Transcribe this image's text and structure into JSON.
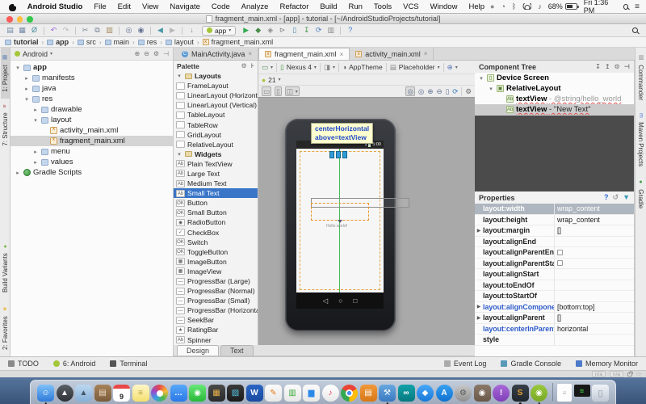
{
  "icons": {
    "close": "×",
    "caret": "▾",
    "tree_open": "▾",
    "tree_closed": "▸",
    "expand": "▶",
    "back_nav": "◁",
    "home_nav": "○",
    "recents_nav": "□",
    "check": "✓"
  },
  "menubar": {
    "items": [
      "Android Studio",
      "File",
      "Edit",
      "View",
      "Navigate",
      "Code",
      "Analyze",
      "Refactor",
      "Build",
      "Run",
      "Tools",
      "VCS",
      "Window",
      "Help"
    ],
    "status_icons": [
      {
        "name": "notifications-icon",
        "glyph": "●",
        "color": "#8a8a8a"
      },
      {
        "name": "time-machine-icon",
        "glyph": "◔",
        "color": "#555555"
      },
      {
        "name": "bluetooth-icon",
        "glyph": "ᛒ",
        "color": "#444444"
      },
      {
        "name": "wifi-icon",
        "glyph": "wifi",
        "color": "#444444"
      },
      {
        "name": "volume-icon",
        "glyph": "♪",
        "color": "#444444"
      }
    ],
    "battery_label": "68%",
    "clock": "Fri 1:36 PM"
  },
  "window": {
    "title": "fragment_main.xml - [app] - tutorial - [~/AndroidStudioProjects/tutorial]"
  },
  "toolbar": {
    "run_config": "app",
    "left_icons": [
      {
        "name": "open-icon",
        "glyph": "▤",
        "color": "#7288a8"
      },
      {
        "name": "save-all-icon",
        "glyph": "▦",
        "color": "#7288a8"
      },
      {
        "name": "synchronize-icon",
        "glyph": "Ø",
        "color": "#4a8a9a"
      },
      {
        "sep": true
      },
      {
        "name": "undo-icon",
        "glyph": "↶",
        "color": "#9a6ad8"
      },
      {
        "name": "redo-icon",
        "glyph": "↷",
        "color": "#b5b5b5"
      },
      {
        "sep": true
      },
      {
        "name": "cut-icon",
        "glyph": "✂",
        "color": "#708090"
      },
      {
        "name": "copy-icon",
        "glyph": "⧉",
        "color": "#708090"
      },
      {
        "name": "paste-icon",
        "glyph": "▥",
        "color": "#a08858"
      },
      {
        "sep": true
      },
      {
        "name": "find-icon",
        "glyph": "◎",
        "color": "#607090"
      },
      {
        "name": "replace-icon",
        "glyph": "◉",
        "color": "#607090"
      },
      {
        "sep": true
      },
      {
        "name": "back-icon",
        "glyph": "◀",
        "color": "#4a9aa8"
      },
      {
        "name": "forward-icon",
        "glyph": "▶",
        "color": "#b8b8b8"
      },
      {
        "sep": true
      },
      {
        "name": "collapse-icon",
        "glyph": "↓",
        "color": "#888888"
      }
    ],
    "right_icons": [
      {
        "name": "run-icon",
        "glyph": "▶",
        "color": "#34a853"
      },
      {
        "name": "debug-icon",
        "glyph": "◆",
        "color": "#4a8a4a"
      },
      {
        "name": "coverage-icon",
        "glyph": "◈",
        "color": "#888888"
      },
      {
        "name": "attach-debugger-icon",
        "glyph": "⊳",
        "color": "#888888"
      },
      {
        "name": "avd-manager-icon",
        "glyph": "▯",
        "color": "#4a8ab0"
      },
      {
        "name": "sdk-manager-icon",
        "glyph": "↧",
        "color": "#4a9a4a"
      },
      {
        "name": "sync-gradle-icon",
        "glyph": "⟳",
        "color": "#4a7ab8"
      },
      {
        "name": "monitor-icon",
        "glyph": "▥",
        "color": "#888888"
      },
      {
        "sep": true
      },
      {
        "name": "help-icon",
        "glyph": "?",
        "color": "#3a7ad8"
      }
    ]
  },
  "breadcrumbs": [
    {
      "label": "tutorial",
      "bold": true
    },
    {
      "label": "app",
      "bold": true
    },
    {
      "label": "src"
    },
    {
      "label": "main"
    },
    {
      "label": "res"
    },
    {
      "label": "layout"
    },
    {
      "label": "fragment_main.xml",
      "file": true
    }
  ],
  "left_strip": {
    "top": [
      {
        "label": "1: Project",
        "glyph": "▦",
        "color": "#6a8ab8",
        "active": true
      },
      {
        "label": "7: Structure",
        "glyph": "≡",
        "color": "#b05050"
      }
    ],
    "bottom": [
      {
        "label": "Build Variants",
        "glyph": "●",
        "color": "#7ab648"
      },
      {
        "label": "2: Favorites",
        "glyph": "★",
        "color": "#e8b838"
      }
    ]
  },
  "project": {
    "selector": "Android",
    "header_icons": [
      {
        "name": "locate-icon",
        "glyph": "⊕"
      },
      {
        "name": "collapse-all-icon",
        "glyph": "⊖"
      },
      {
        "name": "settings-icon",
        "glyph": "⚙"
      },
      {
        "name": "hide-panel-icon",
        "glyph": "⊣"
      }
    ],
    "tree": [
      {
        "label": "app",
        "depth": 0,
        "arrow": "open",
        "icon": "folder",
        "bold": true
      },
      {
        "label": "manifests",
        "depth": 1,
        "arrow": "closed",
        "icon": "folder"
      },
      {
        "label": "java",
        "depth": 1,
        "arrow": "closed",
        "icon": "folder"
      },
      {
        "label": "res",
        "depth": 1,
        "arrow": "open",
        "icon": "folder"
      },
      {
        "label": "drawable",
        "depth": 2,
        "arrow": "closed",
        "icon": "folder"
      },
      {
        "label": "layout",
        "depth": 2,
        "arrow": "open",
        "icon": "folder"
      },
      {
        "label": "activity_main.xml",
        "depth": 3,
        "icon": "xml"
      },
      {
        "label": "fragment_main.xml",
        "depth": 3,
        "icon": "xml",
        "selected": true
      },
      {
        "label": "menu",
        "depth": 2,
        "arrow": "closed",
        "icon": "folder"
      },
      {
        "label": "values",
        "depth": 2,
        "arrow": "closed",
        "icon": "folder"
      },
      {
        "label": "Gradle Scripts",
        "depth": 0,
        "arrow": "closed",
        "icon": "gradle"
      }
    ]
  },
  "editor_tabs": [
    {
      "label": "MainActivity.java",
      "kind": "java"
    },
    {
      "label": "fragment_main.xml",
      "kind": "xml",
      "active": true
    },
    {
      "label": "activity_main.xml",
      "kind": "xml"
    }
  ],
  "palette": {
    "title": "Palette",
    "header_icons": [
      {
        "name": "settings-icon",
        "glyph": "⚙"
      },
      {
        "name": "pin-icon",
        "glyph": "⊦"
      }
    ],
    "sections": [
      {
        "title": "Layouts",
        "items": [
          "FrameLayout",
          "LinearLayout (Horizontal)",
          "LinearLayout (Vertical)",
          "TableLayout",
          "TableRow",
          "GridLayout",
          "RelativeLayout"
        ]
      },
      {
        "title": "Widgets",
        "items": [
          "Plain TextView",
          "Large Text",
          "Medium Text",
          "Small Text",
          "Button",
          "Small Button",
          "RadioButton",
          "CheckBox",
          "Switch",
          "ToggleButton",
          "ImageButton",
          "ImageView",
          "ProgressBar (Large)",
          "ProgressBar (Normal)",
          "ProgressBar (Small)",
          "ProgressBar (Horizontal)",
          "SeekBar",
          "RatingBar",
          "Spinner"
        ]
      }
    ],
    "selected_item": "Small Text"
  },
  "design_bar": {
    "row1": [
      {
        "name": "configuration-menu",
        "glyph": "▭",
        "gcolor": "#5a8a5a",
        "caret": true
      },
      {
        "sep": true
      },
      {
        "name": "device-selector",
        "glyph": "▯",
        "gcolor": "#4a9a4a",
        "label": "Nexus 4",
        "caret": true
      },
      {
        "sep": true
      },
      {
        "name": "orientation-selector",
        "glyph": "◨",
        "gcolor": "#888888",
        "caret": true
      },
      {
        "sep": true
      },
      {
        "name": "theme-selector",
        "glyph": "◑",
        "gcolor": "#555555",
        "label": "AppTheme"
      },
      {
        "sep": true
      },
      {
        "name": "placeholder-selector",
        "glyph": "▤",
        "gcolor": "#888888",
        "label": "Placeholder",
        "caret": true
      },
      {
        "sep": true
      },
      {
        "name": "locale-selector",
        "glyph": "⊕",
        "gcolor": "#5a7ab8",
        "caret": true
      }
    ],
    "row2": [
      {
        "name": "api-level-selector",
        "glyph": "●",
        "gcolor": "#a4c639",
        "label": "21",
        "caret": true
      }
    ],
    "row3_left": [
      {
        "name": "show-bounds-icon",
        "glyph": "▭",
        "gcolor": "#777777",
        "boxed": true
      },
      {
        "name": "device-frame-icon",
        "glyph": "▯",
        "gcolor": "#777777",
        "boxed": true
      },
      {
        "name": "overlay-menu-icon",
        "glyph": "◫",
        "gcolor": "#777777",
        "boxed": true,
        "caret": true
      }
    ],
    "row3_right": [
      {
        "name": "zoom-fit-icon",
        "glyph": "◎",
        "gcolor": "#607090",
        "boxed": true
      },
      {
        "name": "zoom-actual-icon",
        "glyph": "◎",
        "gcolor": "#607090"
      },
      {
        "name": "zoom-in-icon",
        "glyph": "⊕",
        "gcolor": "#607090"
      },
      {
        "name": "zoom-out-icon",
        "glyph": "⊖",
        "gcolor": "#607090"
      },
      {
        "name": "zoom-page-icon",
        "glyph": "▯",
        "gcolor": "#607090"
      },
      {
        "name": "refresh-icon",
        "glyph": "⟳",
        "gcolor": "#3a7ab8"
      },
      {
        "sep": true
      },
      {
        "name": "settings-icon",
        "glyph": "⚙",
        "gcolor": "#666666"
      }
    ]
  },
  "canvas": {
    "tooltip_line1": "centerHorizontal",
    "tooltip_line2": "above=textView",
    "status_time": "5:00",
    "hello_text": "Hello world!"
  },
  "component_tree": {
    "title": "Component Tree",
    "header_icons": [
      {
        "name": "expand-all-icon",
        "glyph": "↧"
      },
      {
        "name": "collapse-all-icon",
        "glyph": "↥"
      },
      {
        "name": "settings-icon",
        "glyph": "⚙"
      },
      {
        "name": "hide-panel-icon",
        "glyph": "⊣"
      }
    ],
    "nodes": [
      {
        "label": "Device Screen",
        "depth": 0,
        "arrow": true,
        "icon": "▯"
      },
      {
        "label": "RelativeLayout",
        "depth": 1,
        "arrow": true,
        "icon": "▣"
      },
      {
        "label": "textView",
        "suffix": "- @string/hello_world",
        "depth": 2,
        "icon": "Ab",
        "error": true
      },
      {
        "label": "textView",
        "suffix": "- \"New Text\"",
        "depth": 2,
        "icon": "Ab",
        "error": true,
        "selected": true
      }
    ]
  },
  "properties": {
    "title": "Properties",
    "header_icons": [
      {
        "name": "help-icon",
        "glyph": "?",
        "color": "#2a6ad8"
      },
      {
        "name": "revert-icon",
        "glyph": "↺",
        "color": "#999999"
      },
      {
        "name": "filter-icon",
        "glyph": "▼",
        "color": "#3a9ab8"
      }
    ],
    "rows": [
      {
        "name": "layout:width",
        "value": "wrap_content",
        "selected": true
      },
      {
        "name": "layout:height",
        "value": "wrap_content"
      },
      {
        "name": "layout:margin",
        "value": "[]",
        "expand": true
      },
      {
        "name": "layout:alignEnd",
        "value": ""
      },
      {
        "name": "layout:alignParentEnd",
        "value": "",
        "checkbox": true
      },
      {
        "name": "layout:alignParentStart",
        "value": "",
        "checkbox": true
      },
      {
        "name": "layout:alignStart",
        "value": ""
      },
      {
        "name": "layout:toEndOf",
        "value": ""
      },
      {
        "name": "layout:toStartOf",
        "value": ""
      },
      {
        "name": "layout:alignComponent",
        "value": "[bottom:top]",
        "expand": true,
        "blue": true
      },
      {
        "name": "layout:alignParent",
        "value": "[]",
        "expand": true
      },
      {
        "name": "layout:centerInParent",
        "value": "horizontal",
        "blue": true
      },
      {
        "name": "style",
        "value": ""
      }
    ]
  },
  "right_strip": [
    {
      "label": "Commander",
      "glyph": "▥",
      "color": "#888888"
    },
    {
      "label": "Maven Projects",
      "glyph": "m",
      "color": "#5a7ad8"
    },
    {
      "label": "Gradle",
      "glyph": "●",
      "color": "#4a9a4a"
    }
  ],
  "bottom_bar": {
    "left": [
      {
        "label": "TODO",
        "glyph": "▤",
        "color": "#8a8a8a"
      },
      {
        "label": "6: Android",
        "glyph": "●",
        "color": "#a4c639"
      },
      {
        "label": "Terminal",
        "glyph": "▣",
        "color": "#555555"
      }
    ],
    "right": [
      {
        "label": "Event Log",
        "glyph": "▤",
        "color": "#aaaaaa"
      },
      {
        "label": "Gradle Console",
        "glyph": "▣",
        "color": "#5a9ab8"
      },
      {
        "label": "Memory Monitor",
        "glyph": "▆",
        "color": "#4a7ac8"
      }
    ]
  },
  "status_strip": {
    "left_value": "n/a",
    "right_value": "n/a"
  },
  "design_text_tabs": [
    {
      "label": "Design",
      "active": true
    },
    {
      "label": "Text"
    }
  ],
  "dock": [
    {
      "name": "finder-icon",
      "glyph": "☺",
      "c1": "#7cc0f8",
      "c2": "#2f7ad8",
      "dot": true
    },
    {
      "name": "launchpad-icon",
      "glyph": "▲",
      "c1": "#5a5f66",
      "c2": "#2e3238",
      "circ": true
    },
    {
      "name": "preview-icon",
      "glyph": "▲",
      "c1": "#bcd8f0",
      "c2": "#88b0d8",
      "fg": "#445566"
    },
    {
      "name": "contacts-icon",
      "glyph": "▤",
      "c1": "#a8825a",
      "c2": "#7a5c3a",
      "fg": "#f0e0c8"
    },
    {
      "name": "calendar-icon",
      "glyph": "9"
    },
    {
      "name": "notes-icon",
      "glyph": "≡",
      "c1": "#fdf6c8",
      "c2": "#f5e070",
      "fg": "#b8a040"
    },
    {
      "name": "photos-icon",
      "glyph": ""
    },
    {
      "name": "messages-icon",
      "glyph": "…",
      "c1": "#58a8f8",
      "c2": "#2a78e8"
    },
    {
      "name": "facetime-icon",
      "glyph": "◉",
      "c1": "#68e878",
      "c2": "#28b838"
    },
    {
      "name": "photo-booth-icon",
      "glyph": "▦",
      "c1": "#4a4a4a",
      "c2": "#2a2a2a",
      "fg": "#e8b048"
    },
    {
      "name": "image-capture-icon",
      "glyph": "▨",
      "c1": "#3a3a3a",
      "c2": "#1a1a1a",
      "fg": "#58c8e8"
    },
    {
      "name": "word-icon",
      "glyph": "W",
      "c1": "#2a66c4",
      "c2": "#1a4aa0"
    },
    {
      "name": "pages-icon",
      "glyph": "✎",
      "c1": "#fafafa",
      "c2": "#e8e8e8",
      "fg": "#e87818"
    },
    {
      "name": "numbers-icon",
      "glyph": "▥",
      "c1": "#fafafa",
      "c2": "#e8e8e8",
      "fg": "#3aa838"
    },
    {
      "name": "keynote-icon",
      "glyph": "▆",
      "c1": "#fafafa",
      "c2": "#e8e8e8",
      "fg": "#2a88e8"
    },
    {
      "name": "itunes-icon",
      "glyph": "♪",
      "c1": "#ffffff",
      "c2": "#e8e8e8",
      "fg": "#e83858",
      "circ": true
    },
    {
      "name": "chrome-icon",
      "glyph": "",
      "circ": true
    },
    {
      "name": "ibooks-icon",
      "glyph": "▤",
      "c1": "#f0983a",
      "c2": "#d87818"
    },
    {
      "name": "xcode-icon",
      "glyph": "⚒",
      "c1": "#68a8e0",
      "c2": "#3a78c0",
      "dot": true
    },
    {
      "name": "arduino-icon",
      "glyph": "∞",
      "c1": "#12a2a8",
      "c2": "#087880"
    },
    {
      "name": "safari-icon",
      "glyph": "◆",
      "c1": "#48a8f8",
      "c2": "#1878d8",
      "circ": true
    },
    {
      "name": "app-store-icon",
      "glyph": "A",
      "c1": "#38a0f0",
      "c2": "#1070d0",
      "circ": true
    },
    {
      "name": "system-preferences-icon",
      "glyph": "⚙",
      "c1": "#c8c8c8",
      "c2": "#909090",
      "fg": "#555555",
      "circ": true
    },
    {
      "name": "gimp-icon",
      "glyph": "◉",
      "c1": "#8a7868",
      "c2": "#6a5848"
    },
    {
      "name": "installer-icon",
      "glyph": "!",
      "c1": "#a868d8",
      "c2": "#8040b8",
      "circ": true
    },
    {
      "name": "sublime-text-icon",
      "glyph": "S",
      "c1": "#38404a",
      "c2": "#20262e",
      "fg": "#e8a030",
      "dot": true
    },
    {
      "name": "android-studio-icon",
      "glyph": "◉",
      "c1": "#9ac83e",
      "c2": "#78a824",
      "circ": true,
      "dot": true
    },
    {
      "sep": true
    },
    {
      "name": "documents-icon",
      "glyph": "≡"
    },
    {
      "name": "screenshot-file-icon",
      "glyph": "≋"
    },
    {
      "name": "trash-icon",
      "glyph": "▯"
    }
  ]
}
